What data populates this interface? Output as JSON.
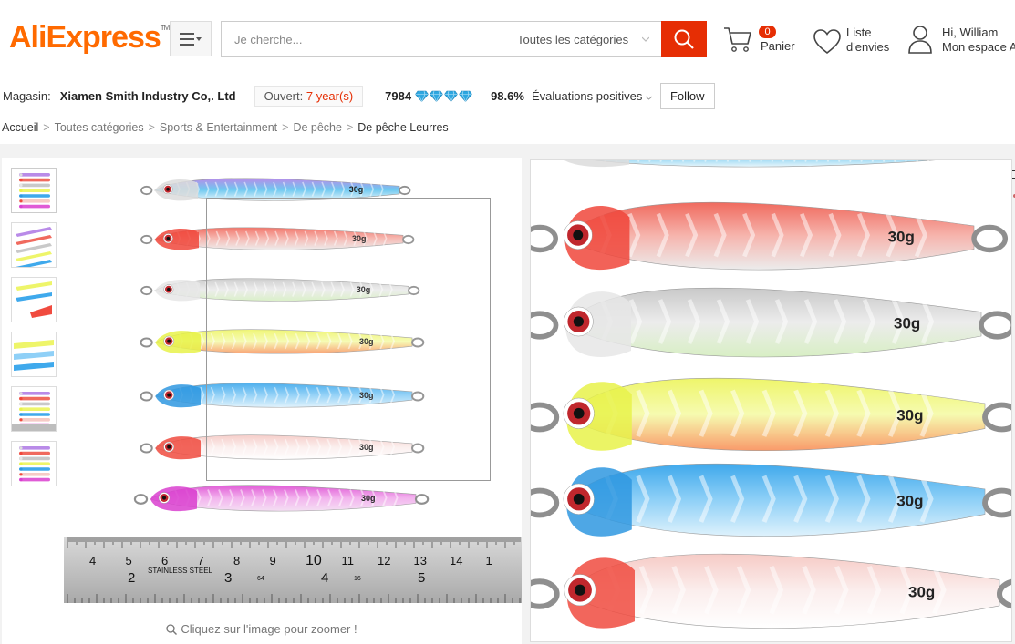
{
  "header": {
    "logo": "AliExpress",
    "logo_tm": "TM",
    "search_placeholder": "Je cherche...",
    "category": "Toutes les catégories",
    "cart_count": "0",
    "cart_label": "Panier",
    "wishlist_line1": "Liste",
    "wishlist_line2": "d'envies",
    "account_line1": "Hi, William",
    "account_line2": "Mon espace A"
  },
  "store": {
    "label": "Magasin:",
    "name": "Xiamen Smith Industry Co,. Ltd",
    "open_prefix": "Ouvert: ",
    "open_years": "7 year(s)",
    "score": "7984",
    "diamond_count": 4,
    "positive_pct": "98.6%",
    "positive_label": "Évaluations positives",
    "follow": "Follow"
  },
  "breadcrumb": {
    "items": [
      "Accueil",
      "Toutes catégories",
      "Sports & Entertainment",
      "De pêche",
      "De pêche Leurres"
    ],
    "separator": ">"
  },
  "gallery": {
    "zoom_hint": "Cliquez sur l'image pour zoomer !",
    "thumbnail_count": 6,
    "lure_weight": "30g",
    "ruler": {
      "top_numbers": [
        "4",
        "5",
        "6",
        "7",
        "8",
        "9",
        "10",
        "11",
        "12",
        "13",
        "14",
        "1"
      ],
      "bottom_numbers": [
        "2",
        "3",
        "4",
        "5"
      ],
      "brand": "STAINLESS STEEL",
      "small_marks": [
        "64",
        "16"
      ]
    }
  },
  "colors": {
    "brand_orange": "#ff6a00",
    "accent_red": "#e62e04",
    "diamond_blue": "#2ea7e0"
  }
}
